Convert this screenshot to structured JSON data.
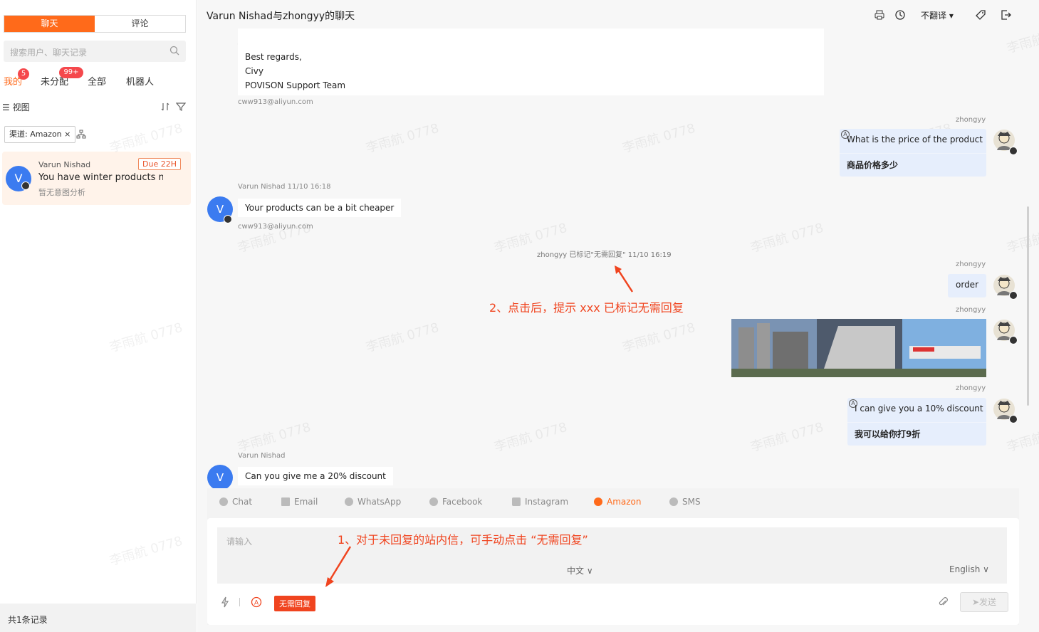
{
  "sidebar": {
    "seg_chat": "聊天",
    "seg_comments": "评论",
    "search_placeholder": "搜索用户、聊天记录",
    "tabs": {
      "mine": "我的",
      "unassigned": "未分配",
      "all": "全部",
      "robot": "机器人"
    },
    "badges": {
      "mine": "5",
      "unassigned": "99+"
    },
    "view_label": "视图",
    "filter_chip": "渠道: Amazon ×",
    "conversation": {
      "avatar_letter": "V",
      "name": "Varun Nishad",
      "due": "Due 22H",
      "message": "You have winter products ma",
      "intent": "暂无意图分析"
    },
    "record_count": "共1条记录"
  },
  "header": {
    "title": "Varun Nishad与zhongyy的聊天",
    "translate_label": "不翻译 ▾"
  },
  "messages": {
    "email_lines": [
      "Best regards,",
      "Civy",
      "POVISON Support Team"
    ],
    "email_from_1": "cww913@aliyun.com",
    "out1_name": "zhongyy",
    "out1_original": "What is the price of the product",
    "out1_translated": "商品价格多少",
    "in1_sender": "Varun Nishad  11/10 16:18",
    "in1_avatar": "V",
    "in1_text": "Your products can be a bit cheaper",
    "in1_email": "cww913@aliyun.com",
    "system_note": "zhongyy 已标记\"无需回复\"  11/10 16:19",
    "out2_name": "zhongyy",
    "out2_text": "order",
    "out3_name": "zhongyy",
    "out4_name": "zhongyy",
    "out4_original": "I can give you a 10% discount",
    "out4_translated": "我可以给你打9折",
    "in2_sender": "Varun Nishad",
    "in2_avatar": "V",
    "in2_text": "Can you give me a 20% discount"
  },
  "annotations": {
    "step2": "2、点击后，提示 xxx 已标记无需回复",
    "step1": "1、对于未回复的站内信，可手动点击 “无需回复”"
  },
  "composer": {
    "channels": [
      "Chat",
      "Email",
      "WhatsApp",
      "Facebook",
      "Instagram",
      "Amazon",
      "SMS"
    ],
    "active_channel": "Amazon",
    "placeholder": "请输入",
    "lang_source": "中文 ∨",
    "lang_target": "English ∨",
    "no_reply_label": "无需回复",
    "send_label": "发送"
  },
  "watermark_text": "李雨航 0778",
  "colors": {
    "accent": "#ff6a1a",
    "annotation": "#f0441f",
    "outgoing_bubble": "#e6eefc",
    "avatar_blue": "#3b7bf0"
  }
}
